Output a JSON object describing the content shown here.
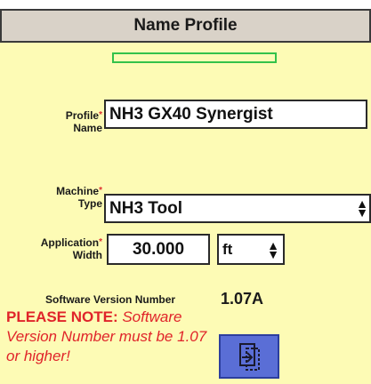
{
  "header": {
    "title": "Name Profile"
  },
  "profile_name": {
    "label_line1": "Profile",
    "label_line2": "Name",
    "required_mark": "*",
    "value": "NH3 GX40 Synergist"
  },
  "machine_type": {
    "label_line1": "Machine",
    "label_line2": "Type",
    "required_mark": "*",
    "value": "NH3 Tool"
  },
  "application_width": {
    "label_line1": "Application",
    "label_line2": "Width",
    "required_mark": "*",
    "value": "30.000",
    "unit": "ft"
  },
  "software": {
    "label": "Software Version Number",
    "version": "1.07A"
  },
  "note": {
    "prefix": "PLEASE NOTE:",
    "text": " Software Version Number must be 1.07 or higher!"
  },
  "colors": {
    "background": "#fdfbb5",
    "title_bar": "#d9d2c8",
    "note_red": "#e0242a",
    "progress_green": "#33c24a",
    "button_blue": "#5a6ed6"
  },
  "icons": {
    "next": "page-forward-icon",
    "spinner": "up-down-arrow-icon"
  }
}
